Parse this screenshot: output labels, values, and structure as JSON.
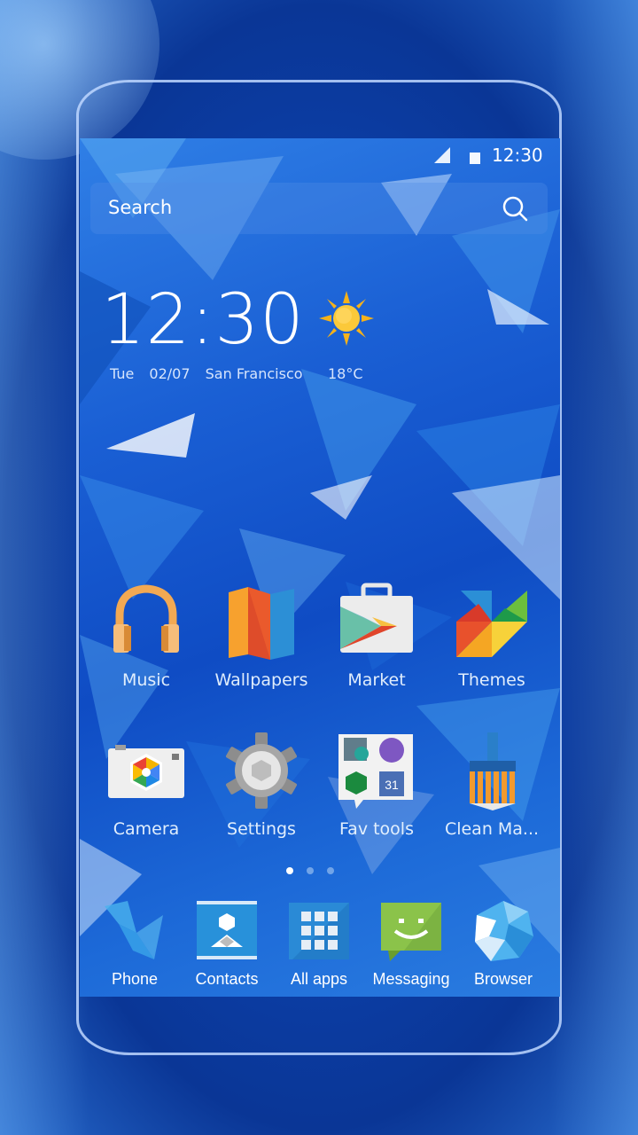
{
  "status_bar": {
    "time": "12:30",
    "icons": [
      "signal-icon",
      "battery-icon"
    ]
  },
  "search": {
    "placeholder": "Search",
    "icon": "search-icon"
  },
  "clock_widget": {
    "time": "12:30",
    "day": "Tue",
    "date": "02/07",
    "city": "San Francisco",
    "temperature": "18°C",
    "weather_icon": "sun-icon"
  },
  "apps_row1": [
    {
      "label": "Music",
      "icon": "headphones-icon"
    },
    {
      "label": "Wallpapers",
      "icon": "folded-map-icon"
    },
    {
      "label": "Market",
      "icon": "play-store-bag-icon"
    },
    {
      "label": "Themes",
      "icon": "pinwheel-icon"
    }
  ],
  "apps_row2": [
    {
      "label": "Camera",
      "icon": "camera-icon"
    },
    {
      "label": "Settings",
      "icon": "gear-icon"
    },
    {
      "label": "Fav tools",
      "icon": "folder-icon"
    },
    {
      "label": "Clean Ma...",
      "icon": "broom-icon"
    }
  ],
  "page_indicator": {
    "pages": 3,
    "current": 1
  },
  "dock": [
    {
      "label": "Phone",
      "icon": "phone-icon"
    },
    {
      "label": "Contacts",
      "icon": "contacts-icon"
    },
    {
      "label": "All apps",
      "icon": "app-grid-icon"
    },
    {
      "label": "Messaging",
      "icon": "message-icon"
    },
    {
      "label": "Browser",
      "icon": "globe-icon"
    }
  ]
}
